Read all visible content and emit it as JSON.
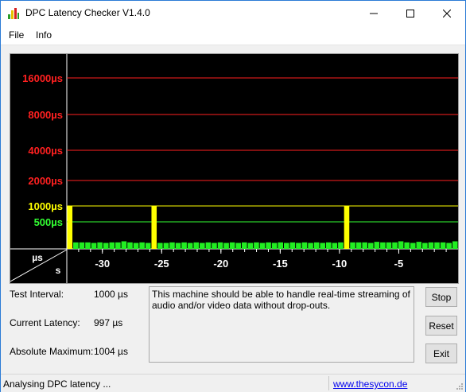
{
  "window": {
    "title": "DPC Latency Checker V1.4.0"
  },
  "menu": {
    "file": "File",
    "info": "Info"
  },
  "chart_data": {
    "type": "bar",
    "x_unit_label": "s",
    "y_unit_label": "µs",
    "y_levels": [
      {
        "label": "16000µs",
        "value": 16000,
        "color": "#ff2020"
      },
      {
        "label": "8000µs",
        "value": 8000,
        "color": "#ff2020"
      },
      {
        "label": "4000µs",
        "value": 4000,
        "color": "#ff2020"
      },
      {
        "label": "2000µs",
        "value": 2000,
        "color": "#ff2020"
      },
      {
        "label": "1000µs",
        "value": 1000,
        "color": "#ffff00"
      },
      {
        "label": "500µs",
        "value": 500,
        "color": "#33ff33"
      }
    ],
    "x_ticks": [
      {
        "label": "-30",
        "value": -30
      },
      {
        "label": "-25",
        "value": -25
      },
      {
        "label": "-20",
        "value": -20
      },
      {
        "label": "-15",
        "value": -15
      },
      {
        "label": "-10",
        "value": -10
      },
      {
        "label": "-5",
        "value": -5
      }
    ],
    "xlim": [
      -33,
      0
    ],
    "bar_colors": {
      "normal": "#22ee22",
      "warning": "#ffff00",
      "high": "#ff2020"
    },
    "values": [
      1004,
      120,
      120,
      120,
      110,
      120,
      110,
      120,
      120,
      140,
      120,
      110,
      120,
      110,
      997,
      110,
      110,
      120,
      110,
      120,
      110,
      120,
      110,
      120,
      110,
      120,
      110,
      120,
      110,
      120,
      110,
      120,
      110,
      120,
      110,
      120,
      110,
      120,
      110,
      120,
      110,
      120,
      110,
      120,
      110,
      120,
      997,
      120,
      120,
      120,
      110,
      130,
      120,
      120,
      120,
      140,
      120,
      110,
      130,
      110,
      120,
      120,
      120,
      110,
      140
    ]
  },
  "info": {
    "test_interval_label": "Test Interval:",
    "test_interval_value": "1000 µs",
    "current_latency_label": "Current Latency:",
    "current_latency_value": "997 µs",
    "absolute_max_label": "Absolute Maximum:",
    "absolute_max_value": "1004 µs"
  },
  "message": "This machine should be able to handle real-time streaming of audio and/or video data without drop-outs.",
  "buttons": {
    "stop": "Stop",
    "reset": "Reset",
    "exit": "Exit"
  },
  "status": {
    "text": "Analysing DPC latency ...",
    "link": "www.thesycon.de"
  }
}
